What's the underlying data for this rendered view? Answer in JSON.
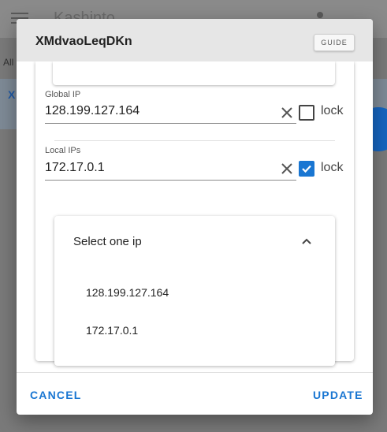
{
  "background": {
    "app_title": "Kashinto",
    "filter_label": "All",
    "selected_item": "X"
  },
  "dialog": {
    "title": "XMdvaoLeqDKn",
    "guide_label": "GUIDE",
    "global_ip": {
      "label": "Global IP",
      "value": "128.199.127.164",
      "lock_label": "lock",
      "locked": false
    },
    "local_ips": {
      "label": "Local IPs",
      "value": "172.17.0.1",
      "lock_label": "lock",
      "locked": true
    },
    "select": {
      "title": "Select one ip",
      "options": [
        "128.199.127.164",
        "172.17.0.1"
      ]
    },
    "cancel_label": "CANCEL",
    "update_label": "UPDATE"
  },
  "colors": {
    "accent": "#1976d2",
    "header_bg": "#e6e6e6"
  }
}
